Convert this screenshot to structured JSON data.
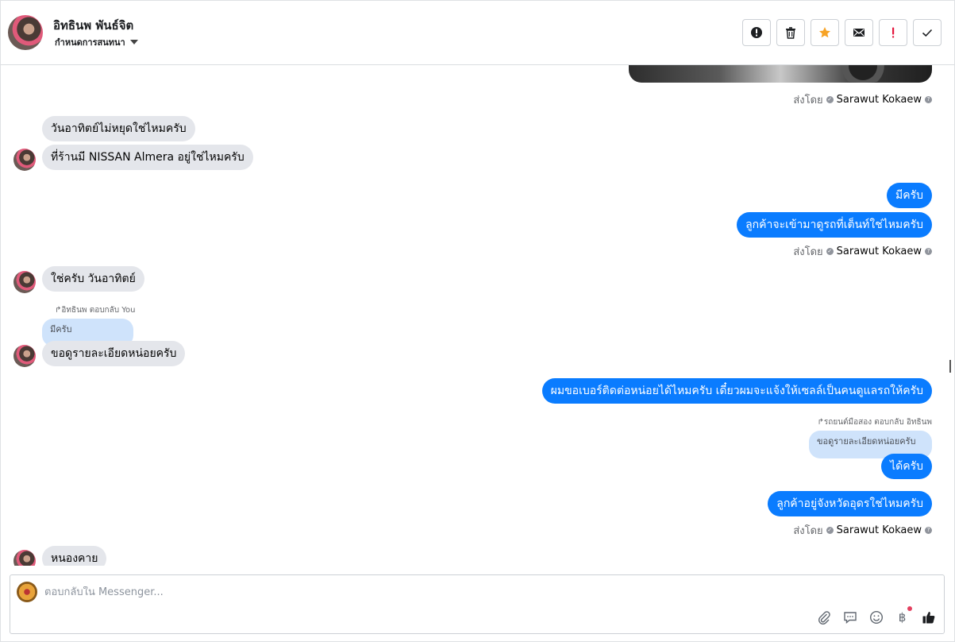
{
  "header": {
    "contact_name": "อิทธินพ พันธ์จิต",
    "status_label": "กำหนดการสนทนา",
    "actions": [
      {
        "name": "alert-icon"
      },
      {
        "name": "trash-icon"
      },
      {
        "name": "star-icon"
      },
      {
        "name": "mail-icon"
      },
      {
        "name": "exclamation-icon"
      },
      {
        "name": "check-icon"
      }
    ]
  },
  "messages": {
    "m1": "วันอาทิตย์ไม่หยุดใช่ไหมครับ",
    "m2": "ที่ร้านมี NISSAN Almera อยู่ใช่ไหมครับ",
    "m3": "มีครับ",
    "m4": "ลูกค้าจะเข้ามาดูรถที่เต็นท์ใช่ไหมครับ",
    "m5": "ใช่ครับ วันอาทิตย์",
    "reply1_meta": "อิทธินพ ตอบกลับ You",
    "reply1_quote": "มีครับ",
    "m6": "ขอดูรายละเอียดหน่อยครับ",
    "m7": "ผมขอเบอร์ติดต่อหน่อยได้ไหมครับ เดี๋ยวผมจะแจ้งให้เซลล์เป็นคนดูแลรถให้ครับ",
    "reply2_meta": "รถยนต์มือสอง ตอบกลับ อิทธินพ",
    "reply2_quote": "ขอดูรายละเอียดหน่อยครับ",
    "m8": "ได้ครับ",
    "m9": "ลูกค้าอยู่จังหวัดอุดรใช่ไหมครับ",
    "m10": "หนองคาย"
  },
  "sent_by": {
    "label": "ส่งโดย",
    "name": "Sarawut Kokaew"
  },
  "composer": {
    "placeholder": "ตอบกลับใน Messenger..."
  },
  "colors": {
    "outgoing": "#0a7cff",
    "incoming": "#e4e6eb",
    "star": "#f7a325",
    "danger": "#e4173e"
  }
}
